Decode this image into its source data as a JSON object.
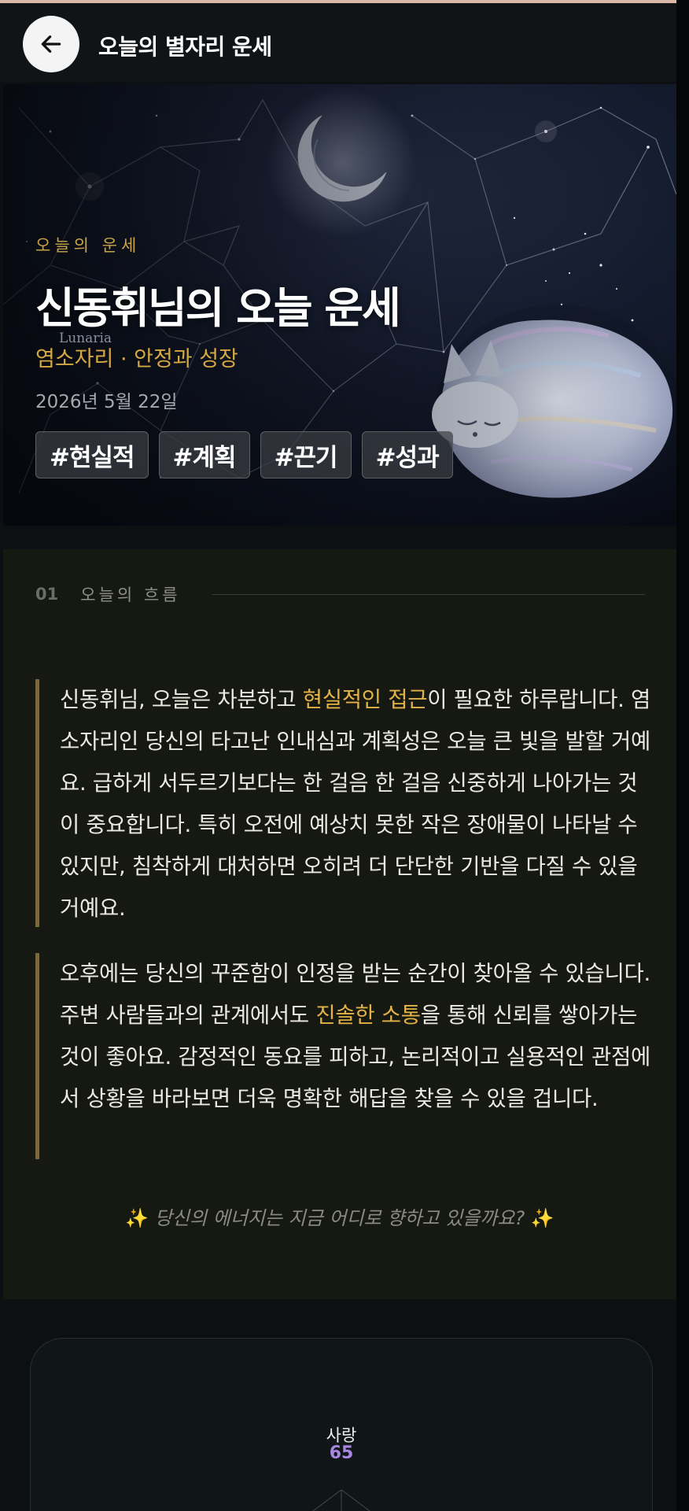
{
  "header": {
    "title": "오늘의 별자리 운세",
    "back_icon": "arrow-left-icon"
  },
  "hero": {
    "eyebrow": "오늘의 운세",
    "title": "신동휘님의 오늘 운세",
    "watermark": "Lunaria",
    "subtitle": "염소자리 · 안정과 성장",
    "date": "2026년 5월 22일",
    "tags": [
      "#현실적",
      "#계획",
      "#끈기",
      "#성과"
    ]
  },
  "section1": {
    "number": "01",
    "label": "오늘의 흐름",
    "p1_before": "신동휘님, 오늘은 차분하고 ",
    "p1_highlight": "현실적인 접근",
    "p1_after": "이 필요한 하루랍니다. 염소자리인 당신의 타고난 인내심과 계획성은 오늘 큰 빛을 발할 거예요. 급하게 서두르기보다는 한 걸음 한 걸음 신중하게 나아가는 것이 중요합니다. 특히 오전에 예상치 못한 작은 장애물이 나타날 수 있지만, 침착하게 대처하면 오히려 더 단단한 기반을 다질 수 있을 거예요.",
    "p2_before": "오후에는 당신의 꾸준함이 인정을 받는 순간이 찾아올 수 있습니다. 주변 사람들과의 관계에서도 ",
    "p2_highlight": "진솔한 소통",
    "p2_after": "을 통해 신뢰를 쌓아가는 것이 좋아요. 감정적인 동요를 피하고, 논리적이고 실용적인 관점에서 상황을 바라보면 더욱 명확한 해답을 찾을 수 있을 겁니다.",
    "quote": "당신의 에너지는 지금 어디로 향하고 있을까요?",
    "spark": "✨"
  },
  "radar": {
    "label": "사랑",
    "value": "65"
  },
  "colors": {
    "accent_gold": "#d6a844",
    "highlight": "#e3b348",
    "radar_value": "#a887e0"
  }
}
